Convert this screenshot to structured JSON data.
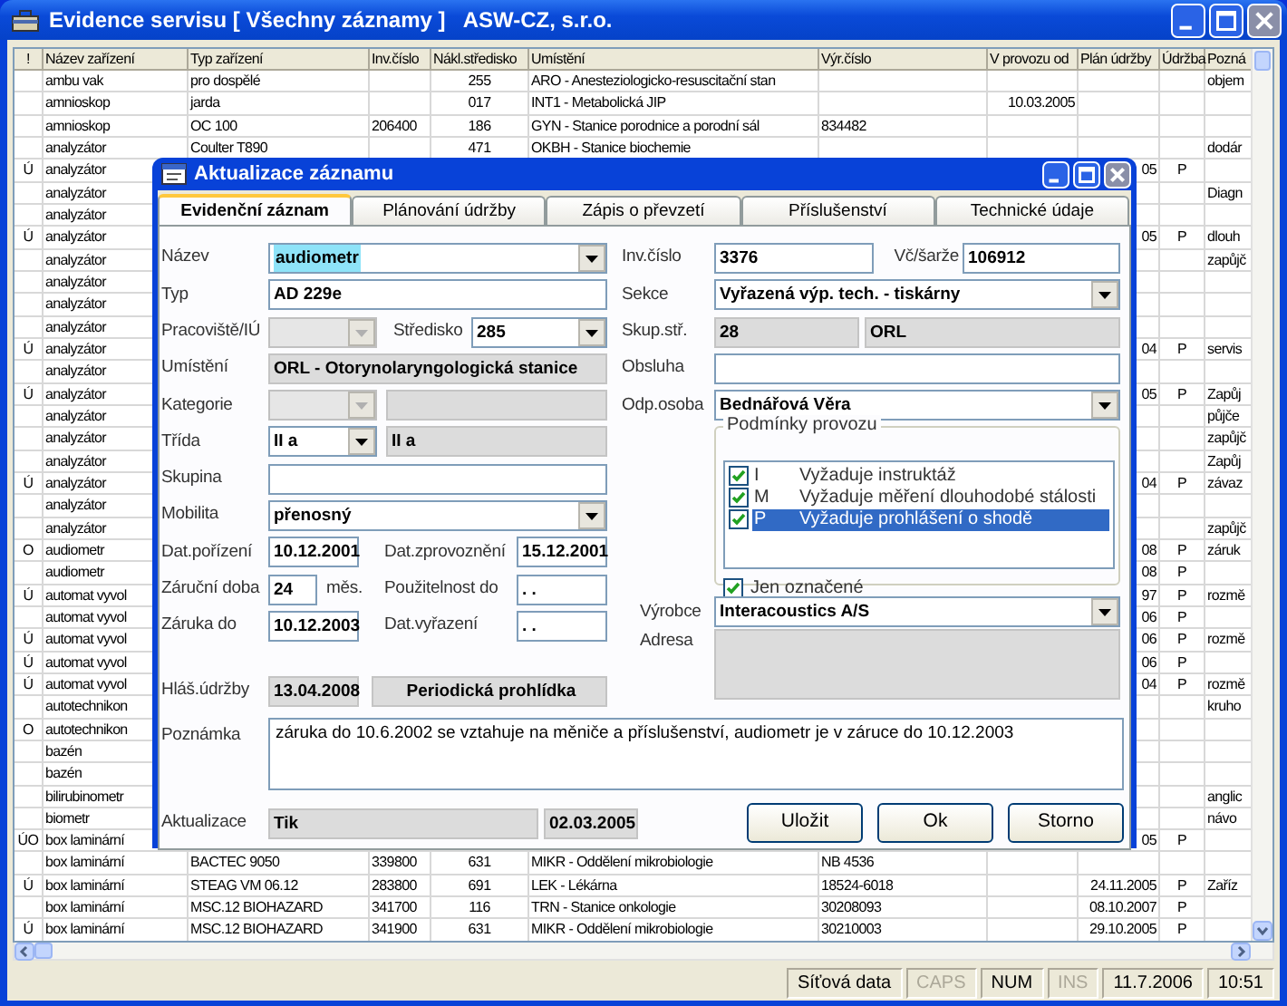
{
  "window": {
    "title": "Evidence servisu [ Všechny záznamy ]   ASW-CZ, s.r.o."
  },
  "table": {
    "columns": [
      "!",
      "Název zařízení",
      "Typ zařízení",
      "Inv.číslo",
      "Nákl.středisko",
      "Umístění",
      "Výr.číslo",
      "V provozu od",
      "Plán údržby",
      "Údržba",
      "Pozná"
    ],
    "rows": [
      {
        "name": "ambu vak",
        "type": "pro dospělé",
        "center": "255",
        "location": "ARO - Anesteziologicko-resuscitační stan",
        "note": "objem"
      },
      {
        "name": "amnioskop",
        "type": "jarda",
        "center": "017",
        "location": "INT1 - Metabolická JIP",
        "since": "10.03.2005"
      },
      {
        "name": "amnioskop",
        "type": "OC 100",
        "inv": "206400",
        "center": "186",
        "location": "GYN - Stanice porodnice a porodní sál",
        "serial": "834482"
      },
      {
        "name": "analyzátor",
        "type": "Coulter T890",
        "center": "471",
        "location": "OKBH - Stanice biochemie",
        "note": "dodár"
      },
      {
        "flag": "Ú",
        "name": "analyzátor",
        "plan": "05",
        "maint": "P"
      },
      {
        "name": "analyzátor",
        "note": "Diagn"
      },
      {
        "name": "analyzátor"
      },
      {
        "flag": "Ú",
        "name": "analyzátor",
        "plan": "05",
        "maint": "P",
        "note": "dlouh"
      },
      {
        "name": "analyzátor",
        "note": "zapůjč"
      },
      {
        "name": "analyzátor"
      },
      {
        "name": "analyzátor"
      },
      {
        "name": "analyzátor"
      },
      {
        "flag": "Ú",
        "name": "analyzátor",
        "plan": "04",
        "maint": "P",
        "note": "servis"
      },
      {
        "name": "analyzátor"
      },
      {
        "flag": "Ú",
        "name": "analyzátor",
        "plan": "05",
        "maint": "P",
        "note": "Zapůj"
      },
      {
        "name": "analyzátor",
        "note": "půjče"
      },
      {
        "name": "analyzátor",
        "note": "zapůjč"
      },
      {
        "name": "analyzátor",
        "note": "Zapůj"
      },
      {
        "flag": "Ú",
        "name": "analyzátor",
        "plan": "04",
        "maint": "P",
        "note": "závaz"
      },
      {
        "name": "analyzátor"
      },
      {
        "name": "analyzátor",
        "note": "zapůjč"
      },
      {
        "flag": "O",
        "name": "audiometr",
        "plan": "08",
        "maint": "P",
        "note": "záruk"
      },
      {
        "name": "audiometr",
        "plan": "08",
        "maint": "P"
      },
      {
        "flag": "Ú",
        "name": "automat vyvol",
        "plan": "97",
        "maint": "P",
        "note": "rozmě"
      },
      {
        "name": "automat vyvol",
        "plan": "06",
        "maint": "P"
      },
      {
        "flag": "Ú",
        "name": "automat vyvol",
        "plan": "06",
        "maint": "P",
        "note": "rozmě"
      },
      {
        "flag": "Ú",
        "name": "automat vyvol",
        "plan": "06",
        "maint": "P"
      },
      {
        "flag": "Ú",
        "name": "automat vyvol",
        "plan": "04",
        "maint": "P",
        "note": "rozmě"
      },
      {
        "name": "autotechnikon",
        "note": "kruho"
      },
      {
        "flag": "O",
        "name": "autotechnikon"
      },
      {
        "name": "bazén"
      },
      {
        "name": "bazén"
      },
      {
        "name": "bilirubinometr",
        "note": "anglic"
      },
      {
        "name": "biometr",
        "note": "návo"
      },
      {
        "flag": "ÚO",
        "name": "box laminární",
        "plan": "05",
        "maint": "P"
      },
      {
        "name": "box laminární",
        "type": "BACTEC 9050",
        "inv": "339800",
        "center": "631",
        "location": "MIKR - Oddělení mikrobiologie",
        "serial": "NB 4536"
      },
      {
        "flag": "Ú",
        "name": "box laminární",
        "type": "STEAG VM 06.12",
        "inv": "283800",
        "center": "691",
        "location": "LEK - Lékárna",
        "serial": "18524-6018",
        "plan": "24.11.2005",
        "maint": "P",
        "note": "Zaříz"
      },
      {
        "name": "box laminární",
        "type": "MSC.12 BIOHAZARD",
        "inv": "341700",
        "center": "116",
        "location": "TRN - Stanice onkologie",
        "serial": "30208093",
        "plan": "08.10.2007",
        "maint": "P"
      },
      {
        "flag": "Ú",
        "name": "box laminární",
        "type": "MSC.12 BIOHAZARD",
        "inv": "341900",
        "center": "631",
        "location": "MIKR - Oddělení mikrobiologie",
        "serial": "30210003",
        "plan": "29.10.2005",
        "maint": "P"
      }
    ]
  },
  "dialog": {
    "title": "Aktualizace záznamu",
    "tabs": [
      {
        "label": "Evidenční záznam",
        "selected": true
      },
      {
        "label": "Plánování údržby",
        "selected": false
      },
      {
        "label": "Zápis o převzetí",
        "selected": false
      },
      {
        "label": "Příslušenství",
        "selected": false
      },
      {
        "label": "Technické údaje",
        "selected": false
      }
    ],
    "fields": {
      "name": {
        "label": "Název",
        "kind": "dropdown",
        "value": "audiometr",
        "text_selected": true,
        "disabled": false
      },
      "type": {
        "label": "Typ",
        "kind": "text",
        "value": "AD 229e"
      },
      "workplace": {
        "label": "Pracoviště/IÚ",
        "kind": "dropdown",
        "disabled": true
      },
      "center": {
        "label": "Středisko",
        "kind": "dropdown",
        "value": "285",
        "disabled": false
      },
      "location": {
        "label": "Umístění",
        "kind": "readonly",
        "value": "ORL - Otorynolaryngologická stanice"
      },
      "category": {
        "label": "Kategorie",
        "kind": "dropdown",
        "disabled": true
      },
      "category_name": {
        "kind": "readonly"
      },
      "class": {
        "label": "Třída",
        "kind": "dropdown",
        "value": "II a",
        "disabled": false
      },
      "class_name": {
        "kind": "readonly",
        "value": "II a"
      },
      "group": {
        "label": "Skupina",
        "kind": "text"
      },
      "mobility": {
        "label": "Mobilita",
        "kind": "dropdown",
        "value": "přenosný",
        "disabled": false
      },
      "purchase_date": {
        "label": "Dat.pořízení",
        "kind": "text",
        "value": "10.12.2001"
      },
      "commission_date": {
        "label": "Dat.zprovoznění",
        "kind": "text",
        "value": "15.12.2001"
      },
      "warranty_period": {
        "label": "Záruční doba",
        "kind": "text",
        "value": "24",
        "unit": "měs."
      },
      "usable_until": {
        "label": "Použitelnost do",
        "kind": "text",
        "value": ". ."
      },
      "warranty_until": {
        "label": "Záruka do",
        "kind": "text",
        "value": "10.12.2003"
      },
      "retirement_date": {
        "label": "Dat.vyřazení",
        "kind": "text",
        "value": ". ."
      },
      "maintenance_report": {
        "label": "Hláš.údržby",
        "kind": "readonly",
        "value": "13.04.2008"
      },
      "maintenance_type": {
        "kind": "readonly",
        "value": "Periodická prohlídka"
      },
      "inv_no": {
        "label": "Inv.číslo",
        "kind": "text",
        "value": "3376"
      },
      "batch_no": {
        "label": "Vč/šarže",
        "kind": "text",
        "value": "106912"
      },
      "section": {
        "label": "Sekce",
        "kind": "dropdown",
        "value": "Vyřazená výp. tech. - tiskárny",
        "disabled": false
      },
      "center_group": {
        "label": "Skup.stř.",
        "kind": "readonly",
        "value": "28"
      },
      "center_group_name": {
        "kind": "readonly",
        "value": "ORL"
      },
      "operator": {
        "label": "Obsluha",
        "kind": "text"
      },
      "responsible": {
        "label": "Odp.osoba",
        "kind": "dropdown",
        "value": "Bednářová Věra",
        "disabled": false
      },
      "manufacturer": {
        "label": "Výrobce",
        "kind": "dropdown",
        "value": "Interacoustics A/S",
        "disabled": false
      },
      "address": {
        "label": "Adresa",
        "kind": "readonly"
      },
      "note": {
        "label": "Poznámka",
        "kind": "memo",
        "value": "záruka do 10.6.2002 se vztahuje na měniče a příslušenství, audiometr je v záruce do 10.12.2003"
      },
      "updated_by": {
        "label": "Aktualizace",
        "kind": "readonly",
        "value": "Tik"
      },
      "updated_on": {
        "kind": "readonly",
        "value": "02.03.2005"
      }
    },
    "conditions": {
      "title": "Podmínky provozu",
      "items": [
        {
          "code": "I",
          "text": "Vyžaduje instruktáž",
          "checked": true,
          "selected": false
        },
        {
          "code": "M",
          "text": "Vyžaduje měření dlouhodobé stálosti",
          "checked": true,
          "selected": false
        },
        {
          "code": "P",
          "text": "Vyžaduje prohlášení o shodě",
          "checked": true,
          "selected": true
        }
      ],
      "only_marked": {
        "label": "Jen označené",
        "checked": true
      }
    },
    "buttons": [
      "Uložit",
      "Ok",
      "Storno"
    ]
  },
  "status_bar": [
    {
      "text": "Síťová data",
      "on": true
    },
    {
      "text": "CAPS",
      "on": false
    },
    {
      "text": "NUM",
      "on": true
    },
    {
      "text": "INS",
      "on": false
    },
    {
      "text": "11.7.2006",
      "on": true
    },
    {
      "text": "10:51",
      "on": true
    }
  ]
}
